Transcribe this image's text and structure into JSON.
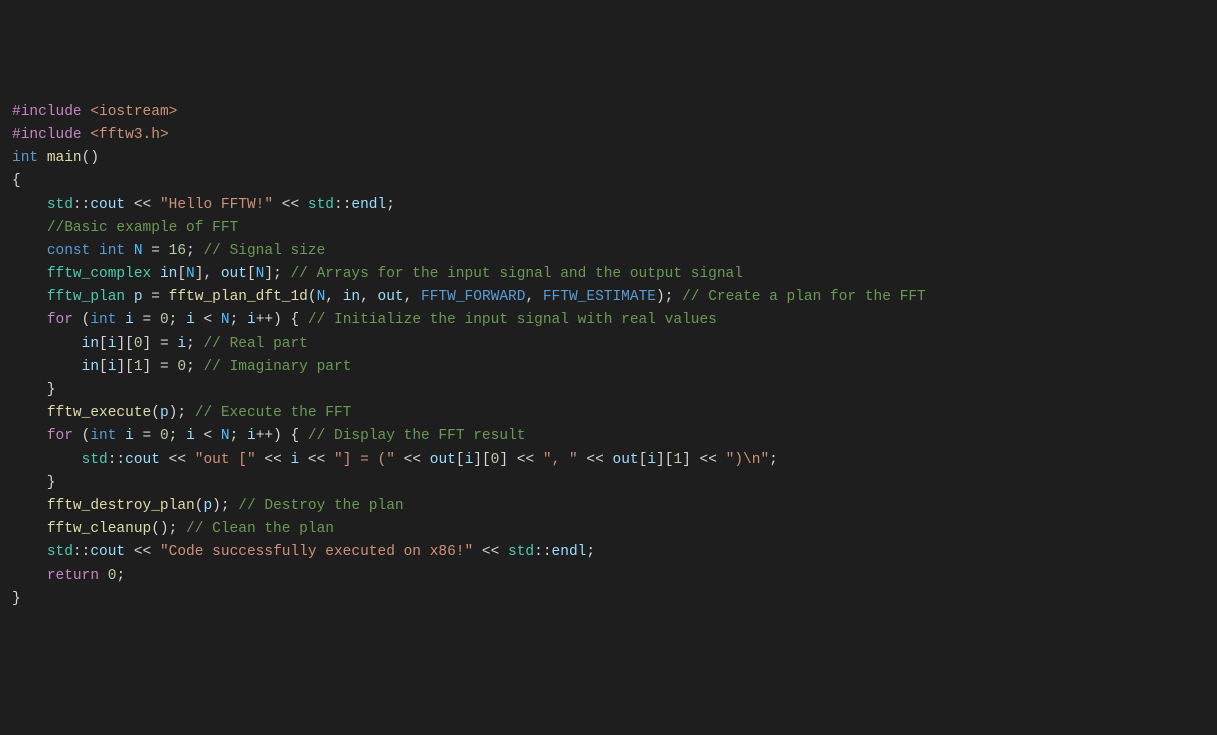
{
  "lines": [
    {
      "segments": [
        {
          "t": "#include ",
          "c": "pp"
        },
        {
          "t": "<iostream>",
          "c": "inc"
        }
      ]
    },
    {
      "segments": [
        {
          "t": "#include ",
          "c": "pp"
        },
        {
          "t": "<fftw3.h>",
          "c": "inc"
        }
      ]
    },
    {
      "segments": [
        {
          "t": "",
          "c": "op"
        }
      ]
    },
    {
      "segments": [
        {
          "t": "int",
          "c": "kw"
        },
        {
          "t": " ",
          "c": "op"
        },
        {
          "t": "main",
          "c": "fn"
        },
        {
          "t": "()",
          "c": "op"
        }
      ]
    },
    {
      "segments": [
        {
          "t": "{",
          "c": "op"
        }
      ]
    },
    {
      "segments": [
        {
          "t": "    ",
          "c": "op"
        },
        {
          "t": "std",
          "c": "ns"
        },
        {
          "t": "::",
          "c": "op"
        },
        {
          "t": "cout",
          "c": "id"
        },
        {
          "t": " << ",
          "c": "op"
        },
        {
          "t": "\"Hello FFTW!\"",
          "c": "str"
        },
        {
          "t": " << ",
          "c": "op"
        },
        {
          "t": "std",
          "c": "ns"
        },
        {
          "t": "::",
          "c": "op"
        },
        {
          "t": "endl",
          "c": "id"
        },
        {
          "t": ";",
          "c": "op"
        }
      ]
    },
    {
      "segments": [
        {
          "t": "    ",
          "c": "op"
        },
        {
          "t": "//Basic example of FFT",
          "c": "com"
        }
      ]
    },
    {
      "segments": [
        {
          "t": "    ",
          "c": "op"
        },
        {
          "t": "const",
          "c": "kw"
        },
        {
          "t": " ",
          "c": "op"
        },
        {
          "t": "int",
          "c": "kw"
        },
        {
          "t": " ",
          "c": "op"
        },
        {
          "t": "N",
          "c": "const"
        },
        {
          "t": " = ",
          "c": "op"
        },
        {
          "t": "16",
          "c": "num"
        },
        {
          "t": "; ",
          "c": "op"
        },
        {
          "t": "// Signal size",
          "c": "com"
        }
      ]
    },
    {
      "segments": [
        {
          "t": "    ",
          "c": "op"
        },
        {
          "t": "fftw_complex",
          "c": "ns"
        },
        {
          "t": " ",
          "c": "op"
        },
        {
          "t": "in",
          "c": "id"
        },
        {
          "t": "[",
          "c": "op"
        },
        {
          "t": "N",
          "c": "const"
        },
        {
          "t": "], ",
          "c": "op"
        },
        {
          "t": "out",
          "c": "id"
        },
        {
          "t": "[",
          "c": "op"
        },
        {
          "t": "N",
          "c": "const"
        },
        {
          "t": "]; ",
          "c": "op"
        },
        {
          "t": "// Arrays for the input signal and the output signal",
          "c": "com"
        }
      ]
    },
    {
      "segments": [
        {
          "t": "    ",
          "c": "op"
        },
        {
          "t": "fftw_plan",
          "c": "ns"
        },
        {
          "t": " ",
          "c": "op"
        },
        {
          "t": "p",
          "c": "id"
        },
        {
          "t": " = ",
          "c": "op"
        },
        {
          "t": "fftw_plan_dft_1d",
          "c": "fn"
        },
        {
          "t": "(",
          "c": "op"
        },
        {
          "t": "N",
          "c": "const"
        },
        {
          "t": ", ",
          "c": "op"
        },
        {
          "t": "in",
          "c": "id"
        },
        {
          "t": ", ",
          "c": "op"
        },
        {
          "t": "out",
          "c": "id"
        },
        {
          "t": ", ",
          "c": "op"
        },
        {
          "t": "FFTW_FORWARD",
          "c": "mac"
        },
        {
          "t": ", ",
          "c": "op"
        },
        {
          "t": "FFTW_ESTIMATE",
          "c": "mac"
        },
        {
          "t": "); ",
          "c": "op"
        },
        {
          "t": "// Create a plan for the FFT",
          "c": "com"
        }
      ]
    },
    {
      "segments": [
        {
          "t": "    ",
          "c": "op"
        },
        {
          "t": "for",
          "c": "pp"
        },
        {
          "t": " (",
          "c": "op"
        },
        {
          "t": "int",
          "c": "kw"
        },
        {
          "t": " ",
          "c": "op"
        },
        {
          "t": "i",
          "c": "id"
        },
        {
          "t": " = ",
          "c": "op"
        },
        {
          "t": "0",
          "c": "num"
        },
        {
          "t": "; ",
          "c": "op"
        },
        {
          "t": "i",
          "c": "id"
        },
        {
          "t": " < ",
          "c": "op"
        },
        {
          "t": "N",
          "c": "const"
        },
        {
          "t": "; ",
          "c": "op"
        },
        {
          "t": "i",
          "c": "id"
        },
        {
          "t": "++) { ",
          "c": "op"
        },
        {
          "t": "// Initialize the input signal with real values",
          "c": "com"
        }
      ]
    },
    {
      "segments": [
        {
          "t": "        ",
          "c": "op"
        },
        {
          "t": "in",
          "c": "id"
        },
        {
          "t": "[",
          "c": "op"
        },
        {
          "t": "i",
          "c": "id"
        },
        {
          "t": "][",
          "c": "op"
        },
        {
          "t": "0",
          "c": "num"
        },
        {
          "t": "] = ",
          "c": "op"
        },
        {
          "t": "i",
          "c": "id"
        },
        {
          "t": "; ",
          "c": "op"
        },
        {
          "t": "// Real part",
          "c": "com"
        }
      ]
    },
    {
      "segments": [
        {
          "t": "        ",
          "c": "op"
        },
        {
          "t": "in",
          "c": "id"
        },
        {
          "t": "[",
          "c": "op"
        },
        {
          "t": "i",
          "c": "id"
        },
        {
          "t": "][",
          "c": "op"
        },
        {
          "t": "1",
          "c": "num"
        },
        {
          "t": "] = ",
          "c": "op"
        },
        {
          "t": "0",
          "c": "num"
        },
        {
          "t": "; ",
          "c": "op"
        },
        {
          "t": "// Imaginary part",
          "c": "com"
        }
      ]
    },
    {
      "segments": [
        {
          "t": "    }",
          "c": "op"
        }
      ]
    },
    {
      "segments": [
        {
          "t": "    ",
          "c": "op"
        },
        {
          "t": "fftw_execute",
          "c": "fn"
        },
        {
          "t": "(",
          "c": "op"
        },
        {
          "t": "p",
          "c": "id"
        },
        {
          "t": "); ",
          "c": "op"
        },
        {
          "t": "// Execute the FFT",
          "c": "com"
        }
      ]
    },
    {
      "segments": [
        {
          "t": "    ",
          "c": "op"
        },
        {
          "t": "for",
          "c": "pp"
        },
        {
          "t": " (",
          "c": "op"
        },
        {
          "t": "int",
          "c": "kw"
        },
        {
          "t": " ",
          "c": "op"
        },
        {
          "t": "i",
          "c": "id"
        },
        {
          "t": " = ",
          "c": "op"
        },
        {
          "t": "0",
          "c": "num"
        },
        {
          "t": "; ",
          "c": "op"
        },
        {
          "t": "i",
          "c": "id"
        },
        {
          "t": " < ",
          "c": "op"
        },
        {
          "t": "N",
          "c": "const"
        },
        {
          "t": "; ",
          "c": "op"
        },
        {
          "t": "i",
          "c": "id"
        },
        {
          "t": "++) { ",
          "c": "op"
        },
        {
          "t": "// Display the FFT result",
          "c": "com"
        }
      ]
    },
    {
      "segments": [
        {
          "t": "        ",
          "c": "op"
        },
        {
          "t": "std",
          "c": "ns"
        },
        {
          "t": "::",
          "c": "op"
        },
        {
          "t": "cout",
          "c": "id"
        },
        {
          "t": " << ",
          "c": "op"
        },
        {
          "t": "\"out [\"",
          "c": "str"
        },
        {
          "t": " << ",
          "c": "op"
        },
        {
          "t": "i",
          "c": "id"
        },
        {
          "t": " << ",
          "c": "op"
        },
        {
          "t": "\"] = (\"",
          "c": "str"
        },
        {
          "t": " << ",
          "c": "op"
        },
        {
          "t": "out",
          "c": "id"
        },
        {
          "t": "[",
          "c": "op"
        },
        {
          "t": "i",
          "c": "id"
        },
        {
          "t": "][",
          "c": "op"
        },
        {
          "t": "0",
          "c": "num"
        },
        {
          "t": "] << ",
          "c": "op"
        },
        {
          "t": "\", \"",
          "c": "str"
        },
        {
          "t": " << ",
          "c": "op"
        },
        {
          "t": "out",
          "c": "id"
        },
        {
          "t": "[",
          "c": "op"
        },
        {
          "t": "i",
          "c": "id"
        },
        {
          "t": "][",
          "c": "op"
        },
        {
          "t": "1",
          "c": "num"
        },
        {
          "t": "] << ",
          "c": "op"
        },
        {
          "t": "\")\\n\"",
          "c": "str"
        },
        {
          "t": ";",
          "c": "op"
        }
      ]
    },
    {
      "segments": [
        {
          "t": "    }",
          "c": "op"
        }
      ]
    },
    {
      "segments": [
        {
          "t": "    ",
          "c": "op"
        },
        {
          "t": "fftw_destroy_plan",
          "c": "fn"
        },
        {
          "t": "(",
          "c": "op"
        },
        {
          "t": "p",
          "c": "id"
        },
        {
          "t": "); ",
          "c": "op"
        },
        {
          "t": "// Destroy the plan",
          "c": "com"
        }
      ]
    },
    {
      "segments": [
        {
          "t": "    ",
          "c": "op"
        },
        {
          "t": "fftw_cleanup",
          "c": "fn"
        },
        {
          "t": "(); ",
          "c": "op"
        },
        {
          "t": "// Clean the plan",
          "c": "com"
        }
      ]
    },
    {
      "segments": [
        {
          "t": "    ",
          "c": "op"
        },
        {
          "t": "std",
          "c": "ns"
        },
        {
          "t": "::",
          "c": "op"
        },
        {
          "t": "cout",
          "c": "id"
        },
        {
          "t": " << ",
          "c": "op"
        },
        {
          "t": "\"Code successfully executed on x86!\"",
          "c": "str"
        },
        {
          "t": " << ",
          "c": "op"
        },
        {
          "t": "std",
          "c": "ns"
        },
        {
          "t": "::",
          "c": "op"
        },
        {
          "t": "endl",
          "c": "id"
        },
        {
          "t": ";",
          "c": "op"
        }
      ]
    },
    {
      "segments": [
        {
          "t": "    ",
          "c": "op"
        },
        {
          "t": "return",
          "c": "pp"
        },
        {
          "t": " ",
          "c": "op"
        },
        {
          "t": "0",
          "c": "num"
        },
        {
          "t": ";",
          "c": "op"
        }
      ]
    },
    {
      "segments": [
        {
          "t": "}",
          "c": "op"
        }
      ]
    }
  ]
}
